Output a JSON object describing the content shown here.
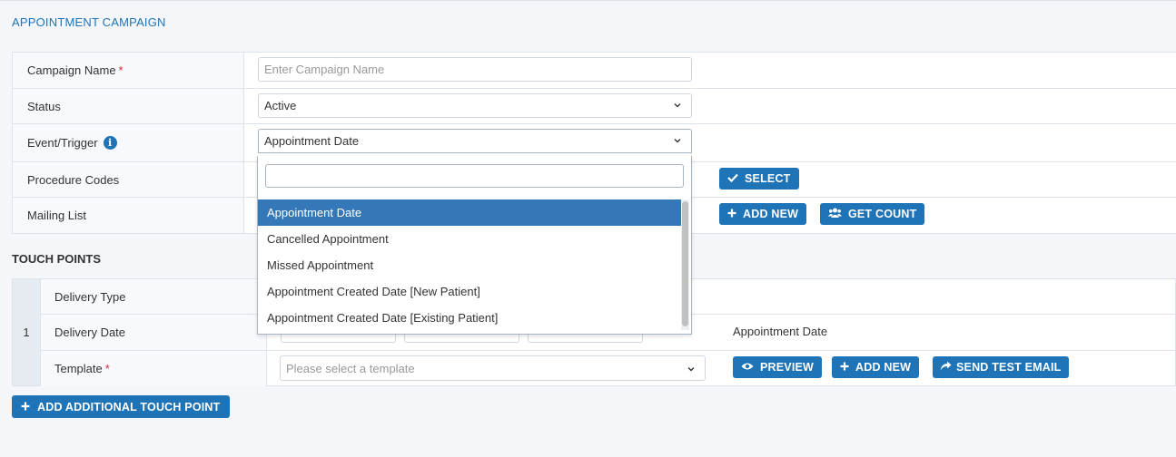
{
  "section_title": "APPOINTMENT CAMPAIGN",
  "form": {
    "campaign_name": {
      "label": "Campaign Name",
      "required": "*",
      "placeholder": "Enter Campaign Name"
    },
    "status": {
      "label": "Status",
      "value": "Active"
    },
    "event_trigger": {
      "label": "Event/Trigger",
      "value": "Appointment Date",
      "info_icon": "info-circle-icon"
    },
    "procedure_codes": {
      "label": "Procedure Codes",
      "select_button": "SELECT"
    },
    "mailing_list": {
      "label": "Mailing List",
      "add_new_button": "ADD NEW",
      "get_count_button": "GET COUNT"
    }
  },
  "dropdown": {
    "options": [
      "Appointment Date",
      "Cancelled Appointment",
      "Missed Appointment",
      "Appointment Created Date [New Patient]",
      "Appointment Created Date [Existing Patient]"
    ],
    "selected_index": 0
  },
  "touch_points": {
    "title": "TOUCH POINTS",
    "number": "1",
    "delivery_type_label": "Delivery Type",
    "delivery_date_label": "Delivery Date",
    "delivery_date_reference": "Appointment Date",
    "template_label": "Template",
    "template_required": "*",
    "template_placeholder": "Please select a template",
    "preview_button": "PREVIEW",
    "add_new_button": "ADD NEW",
    "send_test_email_button": "SEND TEST EMAIL",
    "add_additional_button": "ADD ADDITIONAL TOUCH POINT"
  },
  "colors": {
    "primary": "#1f73b7",
    "selected_option": "#3478b8",
    "required": "#d9263b"
  }
}
